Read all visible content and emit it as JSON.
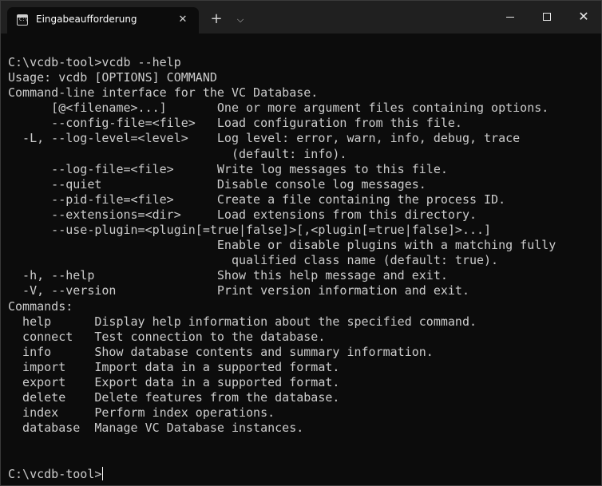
{
  "window": {
    "tab_title": "Eingabeaufforderung",
    "tab_icon_label": "C:\\",
    "tab_close_glyph": "✕",
    "new_tab_glyph": "+",
    "dropdown_glyph": "⌵",
    "minimize_glyph": "—",
    "maximize_glyph": "☐",
    "close_glyph": "✕"
  },
  "terminal": {
    "lines": [
      "C:\\vcdb-tool>vcdb --help",
      "Usage: vcdb [OPTIONS] COMMAND",
      "Command-line interface for the VC Database.",
      "      [@<filename>...]       One or more argument files containing options.",
      "      --config-file=<file>   Load configuration from this file.",
      "  -L, --log-level=<level>    Log level: error, warn, info, debug, trace",
      "                               (default: info).",
      "      --log-file=<file>      Write log messages to this file.",
      "      --quiet                Disable console log messages.",
      "      --pid-file=<file>      Create a file containing the process ID.",
      "      --extensions=<dir>     Load extensions from this directory.",
      "      --use-plugin=<plugin[=true|false]>[,<plugin[=true|false]>...]",
      "                             Enable or disable plugins with a matching fully",
      "                               qualified class name (default: true).",
      "  -h, --help                 Show this help message and exit.",
      "  -V, --version              Print version information and exit.",
      "Commands:",
      "  help      Display help information about the specified command.",
      "  connect   Test connection to the database.",
      "  info      Show database contents and summary information.",
      "  import    Import data in a supported format.",
      "  export    Export data in a supported format.",
      "  delete    Delete features from the database.",
      "  index     Perform index operations.",
      "  database  Manage VC Database instances.",
      "",
      ""
    ],
    "prompt": "C:\\vcdb-tool>"
  }
}
